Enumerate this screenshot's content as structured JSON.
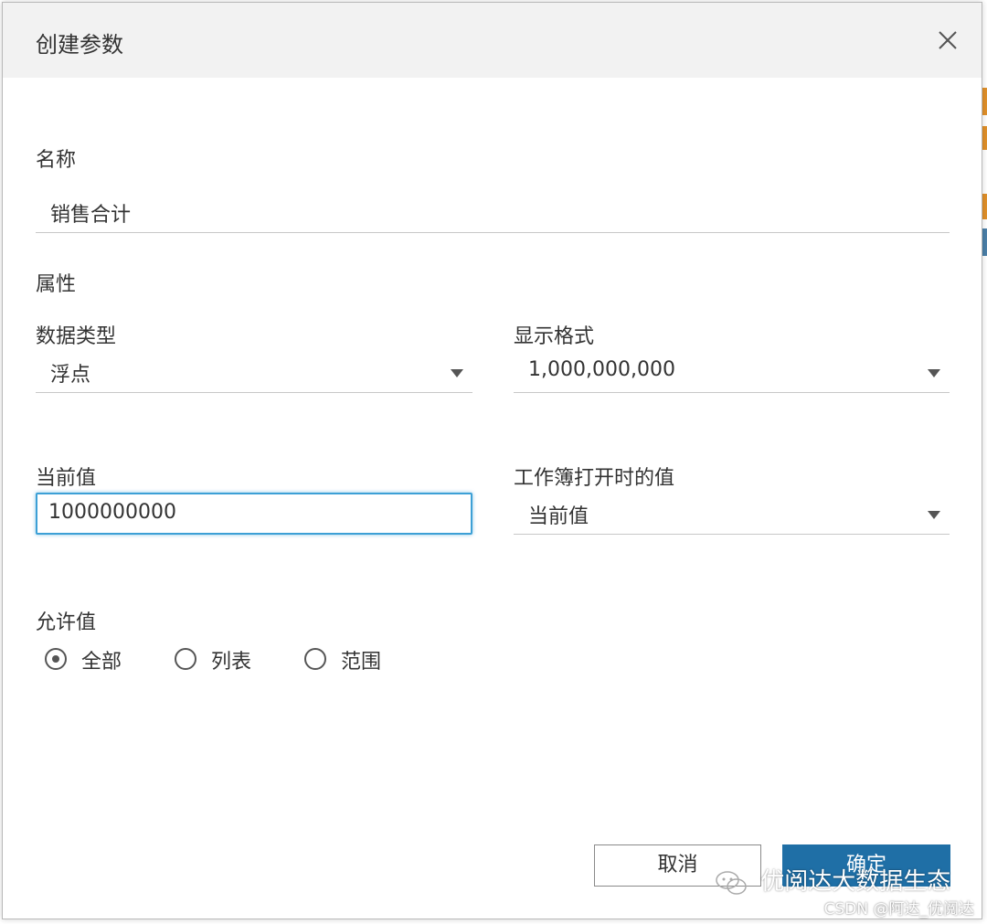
{
  "dialog": {
    "title": "创建参数"
  },
  "name_section": {
    "label": "名称",
    "value": "销售合计"
  },
  "properties": {
    "label": "属性",
    "data_type": {
      "label": "数据类型",
      "selected": "浮点"
    },
    "display_format": {
      "label": "显示格式",
      "selected": "1,000,000,000"
    },
    "current_value": {
      "label": "当前值",
      "value": "1000000000"
    },
    "workbook_open_value": {
      "label": "工作簿打开时的值",
      "selected": "当前值"
    }
  },
  "allowed_values": {
    "label": "允许值",
    "options": [
      {
        "label": "全部",
        "checked": true
      },
      {
        "label": "列表",
        "checked": false
      },
      {
        "label": "范围",
        "checked": false
      }
    ]
  },
  "buttons": {
    "cancel": "取消",
    "ok": "确定"
  },
  "watermark": {
    "text": "优阅达大数据生态",
    "csdn": "CSDN @阿达_优阅达"
  },
  "colors": {
    "accent": "#1f6fa6",
    "focus": "#3da0d6",
    "titlebar": "#f2f2f2"
  }
}
